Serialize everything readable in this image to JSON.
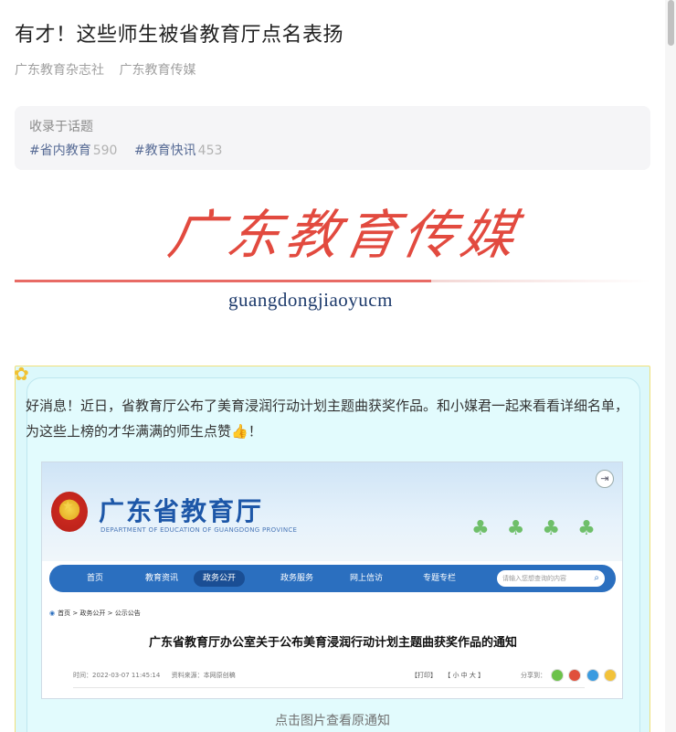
{
  "article": {
    "title": "有才！这些师生被省教育厅点名表扬",
    "meta": [
      "广东教育杂志社",
      "广东教育传媒"
    ]
  },
  "topics": {
    "heading": "收录于话题",
    "tags": [
      {
        "label": "#省内教育",
        "count": "590"
      },
      {
        "label": "#教育快讯",
        "count": "453"
      }
    ]
  },
  "banner": {
    "brand": "广东教育传媒",
    "pinyin": "guangdongjiaoyucm",
    "accent": "#e24a3f"
  },
  "card": {
    "intro": "好消息！近日，省教育厅公布了美育浸润行动计划主题曲获奖作品。和小媒君一起来看看详细名单，为这些上榜的才华满满的师生点赞",
    "thumb_emoji": "👍",
    "intro_end": "！",
    "caption": "点击图片查看原通知",
    "bg_color": "#dcf8fb"
  },
  "gov_site": {
    "name": "广东省教育厅",
    "subtitle": "DEPARTMENT OF EDUCATION OF GUANGDONG PROVINCE",
    "nav": [
      "首页",
      "教育资讯",
      "政务公开",
      "政务服务",
      "网上信访",
      "专题专栏"
    ],
    "active_nav": "政务公开",
    "search_placeholder": "请输入您想查询的内容",
    "breadcrumb": "首页 > 政务公开 > 公示公告",
    "doc_title": "广东省教育厅办公室关于公布美育浸润行动计划主题曲获奖作品的通知",
    "time": "时间：2022-03-07 11:45:14",
    "source": "资料来源：本网原创稿",
    "print": "【打印】",
    "font_size": "【 小   中   大 】",
    "share": "分享到："
  }
}
